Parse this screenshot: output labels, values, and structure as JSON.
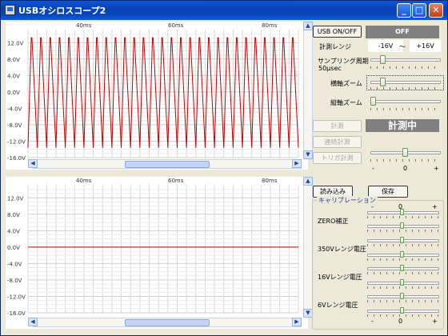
{
  "window": {
    "title": "USBオシロスコープ2",
    "min": "_",
    "max": "□",
    "close": "✕"
  },
  "plots": {
    "x_ticks": [
      "40ms",
      "60ms",
      "80ms"
    ],
    "y_ticks": [
      "12.0V",
      "8.0V",
      "4.0V",
      "0.0V",
      "-4.0V",
      "-8.0V",
      "-12.0V",
      "-16.0V"
    ]
  },
  "chart_data": [
    {
      "type": "line",
      "title": "",
      "x_ticks": [
        "40ms",
        "60ms",
        "80ms"
      ],
      "y_ticks": [
        "12.0V",
        "8.0V",
        "4.0V",
        "0.0V",
        "-4.0V",
        "-8.0V",
        "-12.0V",
        "-16.0V"
      ],
      "ylim": [
        -16,
        14
      ],
      "waveform": "sawtooth",
      "cycles": 29,
      "high": 13.2,
      "low": -13.6,
      "color": "#c80000",
      "grid": true
    },
    {
      "type": "line",
      "title": "",
      "x_ticks": [
        "40ms",
        "60ms",
        "80ms"
      ],
      "y_ticks": [
        "12.0V",
        "8.0V",
        "4.0V",
        "0.0V",
        "-4.0V",
        "-8.0V",
        "-12.0V",
        "-16.0V"
      ],
      "ylim": [
        -16,
        14
      ],
      "waveform": "flat",
      "level": 0.0,
      "color": "#c80000",
      "grid": true
    }
  ],
  "controls": {
    "usb_button": "USB ON/OFF",
    "usb_status": "OFF",
    "range_label": "計測レンジ",
    "range_min": "-16V",
    "range_sep": "〜",
    "range_max": "+16V",
    "sampling_label": "サンプリング周期",
    "sampling_value": "50μsec",
    "hzoom_label": "横軸ズーム",
    "vzoom_label": "縦軸ズーム",
    "measure_button": "計測",
    "measure_status": "計測中",
    "continuous_button": "連続計測",
    "trigger_button": "トリガ計測",
    "trigger_minus": "-",
    "trigger_zero": "0",
    "trigger_plus": "+",
    "load_button": "読み込み",
    "save_button": "保存"
  },
  "calibration": {
    "title": "キャリブレーション",
    "minus": "-",
    "zero": "0",
    "plus": "+",
    "zero_label": "ZERO補正",
    "v350_label": "350Vレンジ電圧",
    "v16_label": "16Vレンジ電圧",
    "v6_label": "6Vレンジ電圧"
  },
  "slider_levels": {
    "sampling": 0.15,
    "hzoom": 0.15,
    "vzoom": 0.0,
    "trigger": 0.5
  },
  "colors": {
    "status_bg": "#808080",
    "trace": "#c80000",
    "group_title": "#1c3aa0"
  }
}
